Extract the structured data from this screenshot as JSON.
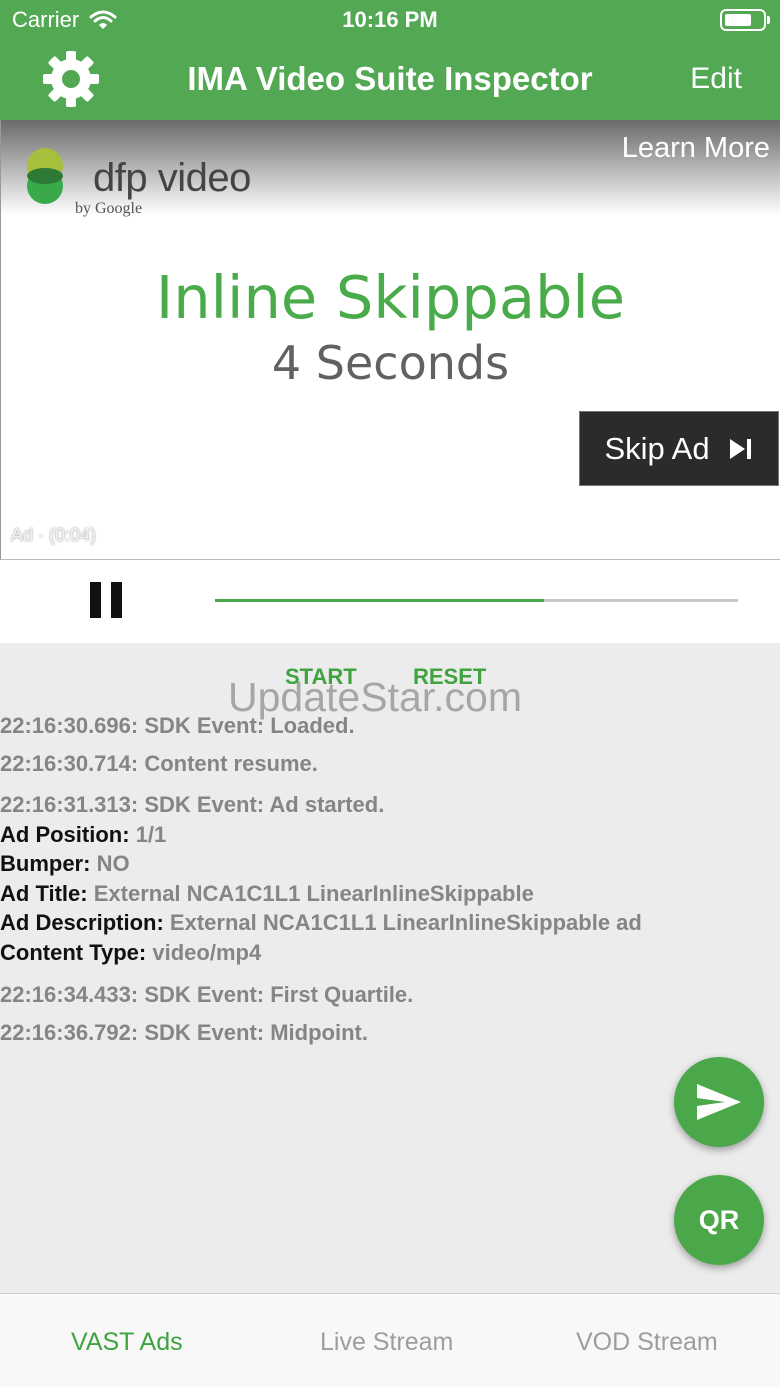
{
  "status_bar": {
    "carrier": "Carrier",
    "time": "10:16 PM"
  },
  "nav": {
    "title": "IMA Video Suite Inspector",
    "edit_label": "Edit",
    "gear_icon": "gear-icon"
  },
  "player": {
    "logo_main": "dfp video",
    "logo_by": "by Google",
    "learn_more": "Learn More",
    "ad_title": "Inline Skippable",
    "ad_subtitle": "4 Seconds",
    "skip_label": "Skip Ad",
    "ad_counter": "Ad · (0:04)"
  },
  "controls": {
    "pause_icon": "pause-icon",
    "progress": 0.63
  },
  "log": {
    "start_label": "START",
    "reset_label": "RESET",
    "watermark": "UpdateStar.com",
    "events": [
      "22:16:30.696: SDK Event: Loaded.",
      "22:16:30.714: Content resume.",
      "22:16:31.313: SDK Event: Ad started."
    ],
    "details": [
      {
        "key": "Ad Position:",
        "value": "1/1"
      },
      {
        "key": "Bumper:",
        "value": "NO"
      },
      {
        "key": "Ad Title:",
        "value": "External NCA1C1L1 LinearInlineSkippable"
      },
      {
        "key": "Ad Description:",
        "value": "External NCA1C1L1 LinearInlineSkippable ad"
      },
      {
        "key": "Content Type:",
        "value": "video/mp4"
      }
    ],
    "later_events": [
      "22:16:34.433: SDK Event: First Quartile.",
      "22:16:36.792: SDK Event: Midpoint."
    ]
  },
  "fab": {
    "send_icon": "send-icon",
    "qr_label": "QR"
  },
  "tabs": [
    {
      "label": "VAST Ads",
      "active": true
    },
    {
      "label": "Live Stream",
      "active": false
    },
    {
      "label": "VOD Stream",
      "active": false
    }
  ],
  "colors": {
    "accent": "#53a853",
    "skip_bg": "#2b2b2b",
    "log_text": "#858585"
  }
}
